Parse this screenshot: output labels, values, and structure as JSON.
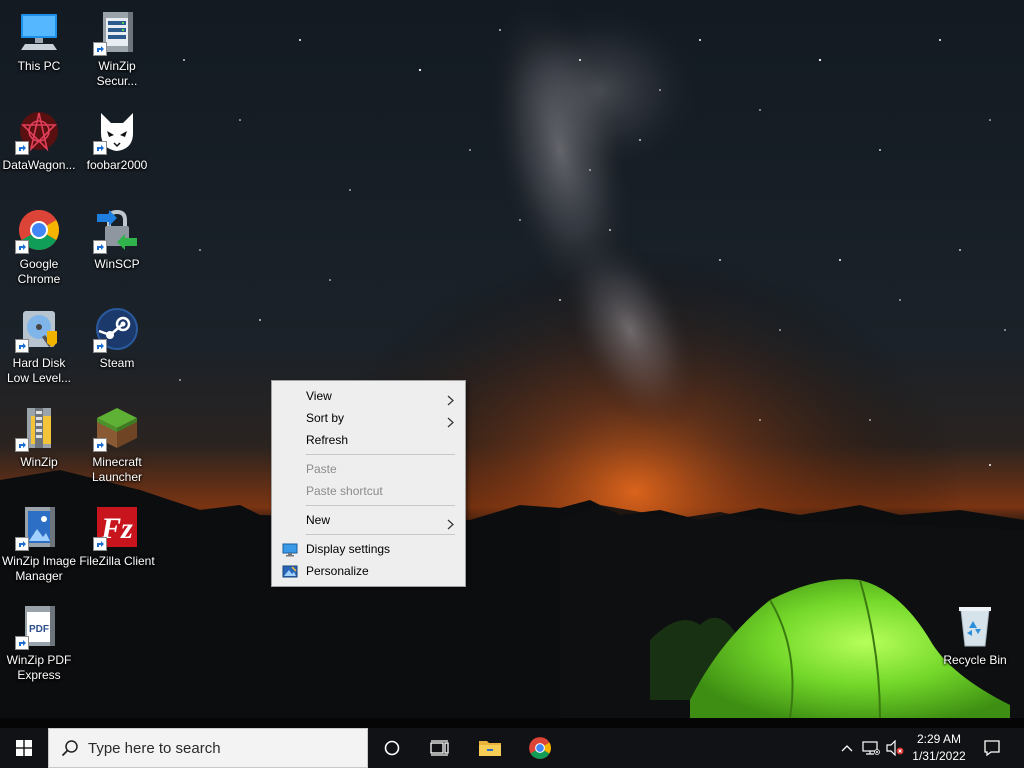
{
  "desktop": {
    "icons": [
      {
        "label": "This PC",
        "icon": "computer-icon"
      },
      {
        "label": "WinZip\nSecur...",
        "icon": "winzip-secure-icon"
      },
      {
        "label": "DataWagon...",
        "icon": "datawagon-icon"
      },
      {
        "label": "foobar2000",
        "icon": "foobar2000-icon"
      },
      {
        "label": "Google\nChrome",
        "icon": "chrome-icon"
      },
      {
        "label": "WinSCP",
        "icon": "winscp-icon"
      },
      {
        "label": "Hard Disk\nLow Level...",
        "icon": "hard-disk-icon"
      },
      {
        "label": "Steam",
        "icon": "steam-icon"
      },
      {
        "label": "WinZip",
        "icon": "winzip-icon"
      },
      {
        "label": "Minecraft\nLauncher",
        "icon": "minecraft-icon"
      },
      {
        "label": "WinZip Image\nManager",
        "icon": "winzip-image-icon"
      },
      {
        "label": "FileZilla Client",
        "icon": "filezilla-icon"
      },
      {
        "label": "WinZip PDF\nExpress",
        "icon": "winzip-pdf-icon"
      },
      {
        "label": "Recycle Bin",
        "icon": "recycle-bin-icon"
      }
    ]
  },
  "context_menu": {
    "view": "View",
    "sort_by": "Sort by",
    "refresh": "Refresh",
    "paste": "Paste",
    "paste_shortcut": "Paste shortcut",
    "new": "New",
    "display_settings": "Display settings",
    "personalize": "Personalize"
  },
  "taskbar": {
    "search_placeholder": "Type here to search",
    "time": "2:29 AM",
    "date": "1/31/2022",
    "icons": [
      "windows-start-icon",
      "search-icon",
      "cortana-icon",
      "task-view-icon",
      "file-explorer-icon",
      "chrome-icon",
      "chevron-up-icon",
      "network-icon",
      "volume-muted-icon",
      "notification-icon"
    ]
  },
  "colors": {
    "taskbar": "#101215",
    "menu_bg": "#eeeeee",
    "tent_green": "#7fe02e",
    "horizon_orange": "#d8641e"
  }
}
